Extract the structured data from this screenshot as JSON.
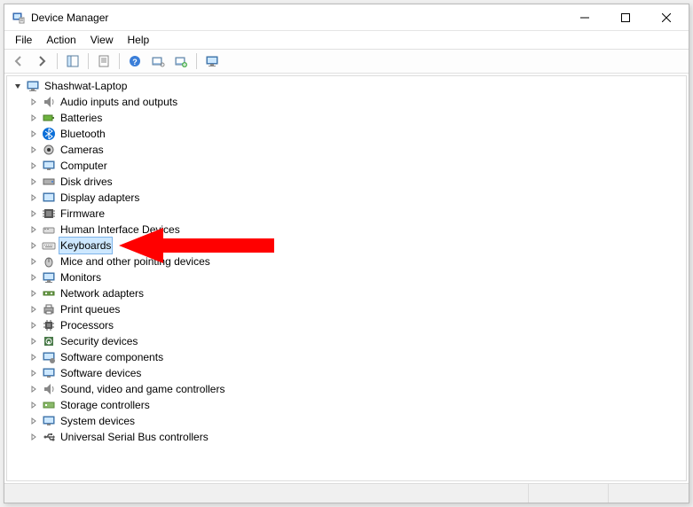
{
  "window": {
    "title": "Device Manager"
  },
  "menu": {
    "file": "File",
    "action": "Action",
    "view": "View",
    "help": "Help"
  },
  "tree": {
    "root": "Shashwat-Laptop",
    "items": [
      "Audio inputs and outputs",
      "Batteries",
      "Bluetooth",
      "Cameras",
      "Computer",
      "Disk drives",
      "Display adapters",
      "Firmware",
      "Human Interface Devices",
      "Keyboards",
      "Mice and other pointing devices",
      "Monitors",
      "Network adapters",
      "Print queues",
      "Processors",
      "Security devices",
      "Software components",
      "Software devices",
      "Sound, video and game controllers",
      "Storage controllers",
      "System devices",
      "Universal Serial Bus controllers"
    ]
  },
  "annotation": {
    "target_index": 9,
    "color": "#ff0000"
  }
}
